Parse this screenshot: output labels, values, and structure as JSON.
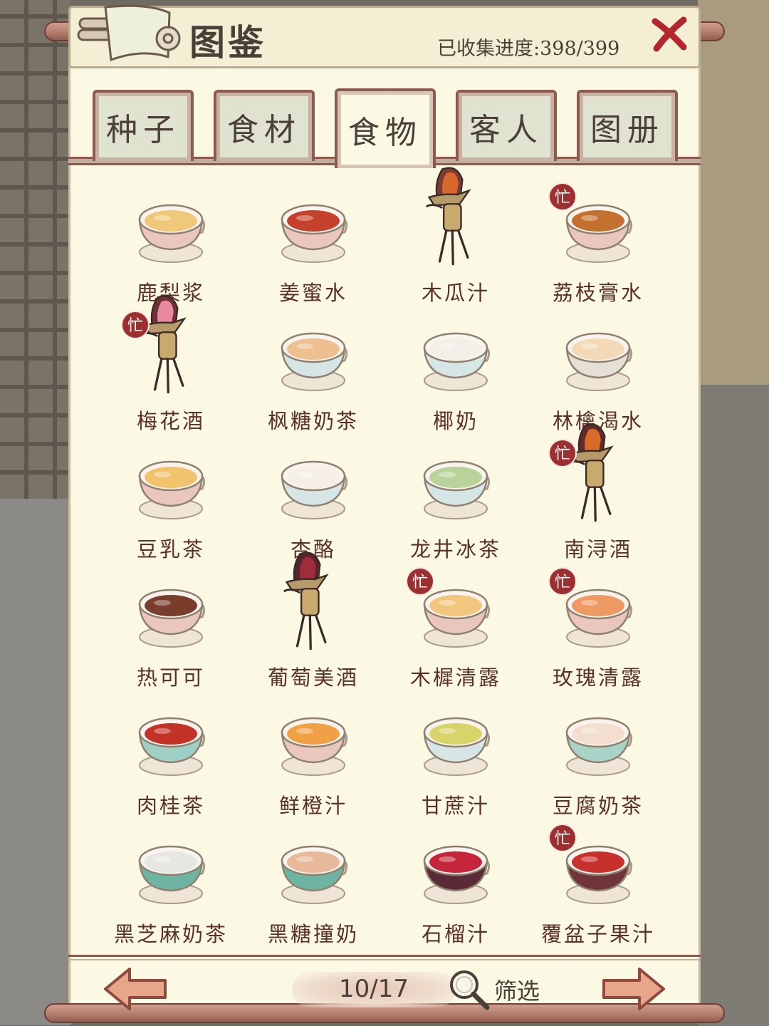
{
  "header": {
    "title": "图鉴",
    "progress": "已收集进度:398/399"
  },
  "tabs": [
    {
      "label": "种子",
      "active": false
    },
    {
      "label": "食材",
      "active": false
    },
    {
      "label": "食物",
      "active": true
    },
    {
      "label": "客人",
      "active": false
    },
    {
      "label": "图册",
      "active": false
    }
  ],
  "badge_text": "忙",
  "items": [
    {
      "label": "鹿梨浆",
      "icon": "cup-icon",
      "liquid": "#f0c87a",
      "rim": "#e9c7bf",
      "badge": false
    },
    {
      "label": "姜蜜水",
      "icon": "cup-icon",
      "liquid": "#c6412c",
      "rim": "#e9c7bf",
      "badge": false
    },
    {
      "label": "木瓜汁",
      "icon": "jue-wine-vessel-icon",
      "liquid": "#d9672e",
      "rim": "#7a3c34",
      "badge": false
    },
    {
      "label": "荔枝膏水",
      "icon": "cup-icon",
      "liquid": "#c4702e",
      "rim": "#e9c7bf",
      "badge": true
    },
    {
      "label": "梅花酒",
      "icon": "jue-wine-vessel-icon",
      "liquid": "#e889a0",
      "rim": "#6e3136",
      "badge": true
    },
    {
      "label": "枫糖奶茶",
      "icon": "cup-icon",
      "liquid": "#eebf8f",
      "rim": "#d6e6e6",
      "badge": false
    },
    {
      "label": "椰奶",
      "icon": "cup-icon",
      "liquid": "#f4eee9",
      "rim": "#d6e6e6",
      "badge": false
    },
    {
      "label": "林檎渴水",
      "icon": "cup-icon",
      "liquid": "#f3d9b6",
      "rim": "#e6e0d6",
      "badge": false
    },
    {
      "label": "豆乳茶",
      "icon": "cup-icon",
      "liquid": "#f2c36d",
      "rim": "#e9c7bf",
      "badge": false
    },
    {
      "label": "杏酪",
      "icon": "cup-icon",
      "liquid": "#f6efe6",
      "rim": "#d6e6e6",
      "badge": false
    },
    {
      "label": "龙井冰茶",
      "icon": "cup-icon",
      "liquid": "#b9d39a",
      "rim": "#d6e6e6",
      "badge": false
    },
    {
      "label": "南浔酒",
      "icon": "jue-wine-vessel-icon",
      "liquid": "#d86a2c",
      "rim": "#5f2c2a",
      "badge": true
    },
    {
      "label": "热可可",
      "icon": "cup-icon",
      "liquid": "#7a3d2c",
      "rim": "#e9c7bf",
      "badge": false
    },
    {
      "label": "葡萄美酒",
      "icon": "jue-wine-vessel-icon",
      "liquid": "#9e2c3c",
      "rim": "#55262c",
      "badge": false
    },
    {
      "label": "木樨清露",
      "icon": "cup-icon",
      "liquid": "#f1c77e",
      "rim": "#e9c7bf",
      "badge": true
    },
    {
      "label": "玫瑰清露",
      "icon": "cup-icon",
      "liquid": "#ee9a62",
      "rim": "#e9c7bf",
      "badge": true
    },
    {
      "label": "肉桂茶",
      "icon": "cup-icon",
      "liquid": "#c23227",
      "rim": "#9fd0c6",
      "badge": false
    },
    {
      "label": "鲜橙汁",
      "icon": "cup-icon",
      "liquid": "#f0a146",
      "rim": "#e9c7bf",
      "badge": false
    },
    {
      "label": "甘蔗汁",
      "icon": "cup-icon",
      "liquid": "#d8d46a",
      "rim": "#d6e6e6",
      "badge": false
    },
    {
      "label": "豆腐奶茶",
      "icon": "cup-icon",
      "liquid": "#f4ded0",
      "rim": "#a7d4c6",
      "badge": false
    },
    {
      "label": "黑芝麻奶茶",
      "icon": "cup-icon",
      "liquid": "#e6e6e2",
      "rim": "#6db5a2",
      "badge": false
    },
    {
      "label": "黑糖撞奶",
      "icon": "cup-icon",
      "liquid": "#e8b89a",
      "rim": "#6db5a2",
      "badge": false
    },
    {
      "label": "石榴汁",
      "icon": "cup-icon",
      "liquid": "#c5253a",
      "rim": "#5a2a36",
      "badge": false
    },
    {
      "label": "覆盆子果汁",
      "icon": "cup-icon",
      "liquid": "#c8302c",
      "rim": "#6e3439",
      "badge": true
    }
  ],
  "footer": {
    "page": "10/17",
    "filter_label": "筛选"
  }
}
